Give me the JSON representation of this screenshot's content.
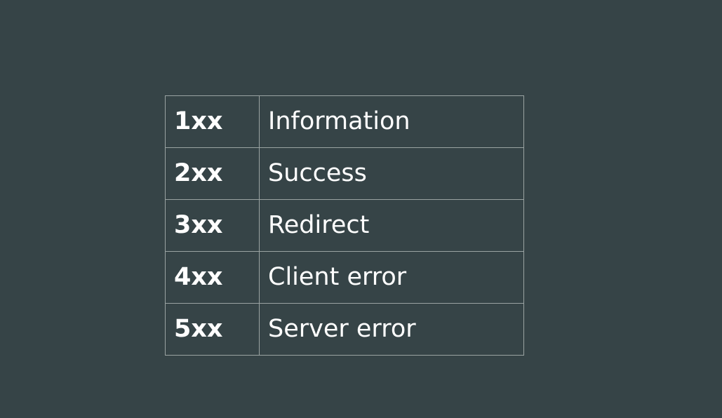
{
  "status_codes": [
    {
      "code": "1xx",
      "meaning": "Information"
    },
    {
      "code": "2xx",
      "meaning": "Success"
    },
    {
      "code": "3xx",
      "meaning": "Redirect"
    },
    {
      "code": "4xx",
      "meaning": "Client error"
    },
    {
      "code": "5xx",
      "meaning": "Server error"
    }
  ],
  "colors": {
    "background": "#364447",
    "border": "#9aa3a2",
    "text": "#ffffff"
  }
}
